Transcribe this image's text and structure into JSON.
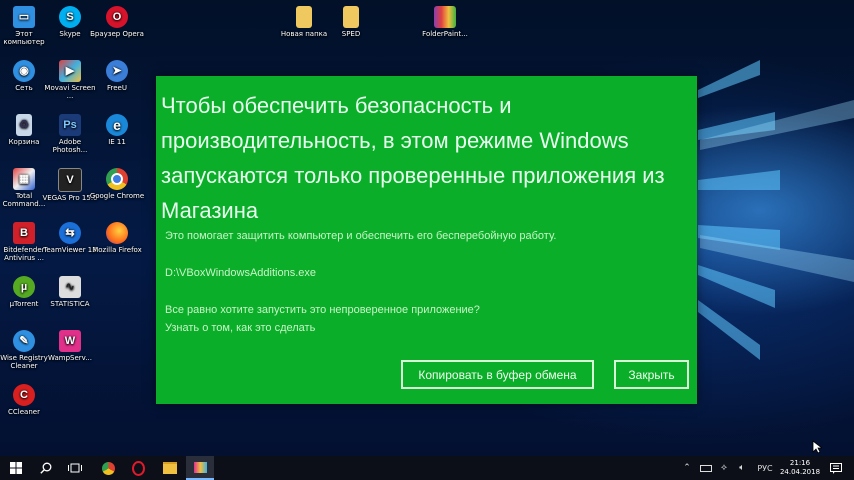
{
  "desktop": {
    "icons": [
      {
        "label": "Этот компьютер",
        "icon": "computer-icon",
        "color": "#2f8fe0"
      },
      {
        "label": "Skype",
        "icon": "skype-icon",
        "color": "#00aff0"
      },
      {
        "label": "Браузер Opera",
        "icon": "opera-icon",
        "color": "#d6132a"
      },
      {
        "label": "Новая папка",
        "icon": "folder-icon",
        "color": "#f0c860"
      },
      {
        "label": "SPED",
        "icon": "folder-icon",
        "color": "#f0c860"
      },
      {
        "label": "FolderPaint...",
        "icon": "folderpaint-icon",
        "color": "#8a3fb0"
      },
      {
        "label": "Сеть",
        "icon": "network-icon",
        "color": "#2f8fe0"
      },
      {
        "label": "Movavi Screen ...",
        "icon": "movavi-icon",
        "color": "#e04040"
      },
      {
        "label": "FreeU",
        "icon": "freeu-icon",
        "color": "#3a7ed8"
      },
      {
        "label": "Корзина",
        "icon": "recycle-bin-icon",
        "color": "#c8d8e8"
      },
      {
        "label": "Adobe Photosh...",
        "icon": "photoshop-icon",
        "color": "#1b3a78"
      },
      {
        "label": "IE 11",
        "icon": "ie-icon",
        "color": "#1a88d8"
      },
      {
        "label": "Total Command...",
        "icon": "total-commander-icon",
        "color": "#d8d8d8"
      },
      {
        "label": "VEGAS Pro 15.0",
        "icon": "vegas-icon",
        "color": "#222222"
      },
      {
        "label": "Google Chrome",
        "icon": "chrome-icon",
        "color": "#e8b020"
      },
      {
        "label": "Bitdefender Antivirus ...",
        "icon": "bitdefender-icon",
        "color": "#d0202a"
      },
      {
        "label": "TeamViewer 13",
        "icon": "teamviewer-icon",
        "color": "#1a6fd8"
      },
      {
        "label": "Mozilla Firefox",
        "icon": "firefox-icon",
        "color": "#ff8a1a"
      },
      {
        "label": "µTorrent",
        "icon": "utorrent-icon",
        "color": "#55aa22"
      },
      {
        "label": "STATISTICA",
        "icon": "statistica-icon",
        "color": "#dddddd"
      },
      {
        "label": "Wise Registry Cleaner",
        "icon": "wise-registry-icon",
        "color": "#2f8fe0"
      },
      {
        "label": "WampServ...",
        "icon": "wampserver-icon",
        "color": "#e0308a"
      },
      {
        "label": "CCleaner",
        "icon": "ccleaner-icon",
        "color": "#d82020"
      }
    ]
  },
  "dialog": {
    "title": "Чтобы обеспечить безопасность и производительность, в этом режиме Windows запускаются только проверенные приложения из Магазина",
    "subtitle": "Это помогает защитить компьютер и обеспечить его бесперебойную работу.",
    "file_path": "D:\\VBoxWindowsAdditions.exe",
    "question": "Все равно хотите запустить это непроверенное приложение?",
    "learn_more_link": "Узнать о том, как это сделать",
    "copy_button": "Копировать в буфер обмена",
    "close_button": "Закрыть",
    "background_color": "#0aae28"
  },
  "taskbar": {
    "start_icon": "windows-start-icon",
    "search_icon": "search-icon",
    "task_view_icon": "task-view-icon",
    "pinned": [
      "chrome-icon",
      "opera-icon",
      "file-explorer-icon",
      "app-icon"
    ],
    "language": "РУС",
    "time": "21:16",
    "date": "24.04.2018",
    "notification_icon": "action-center-icon"
  }
}
